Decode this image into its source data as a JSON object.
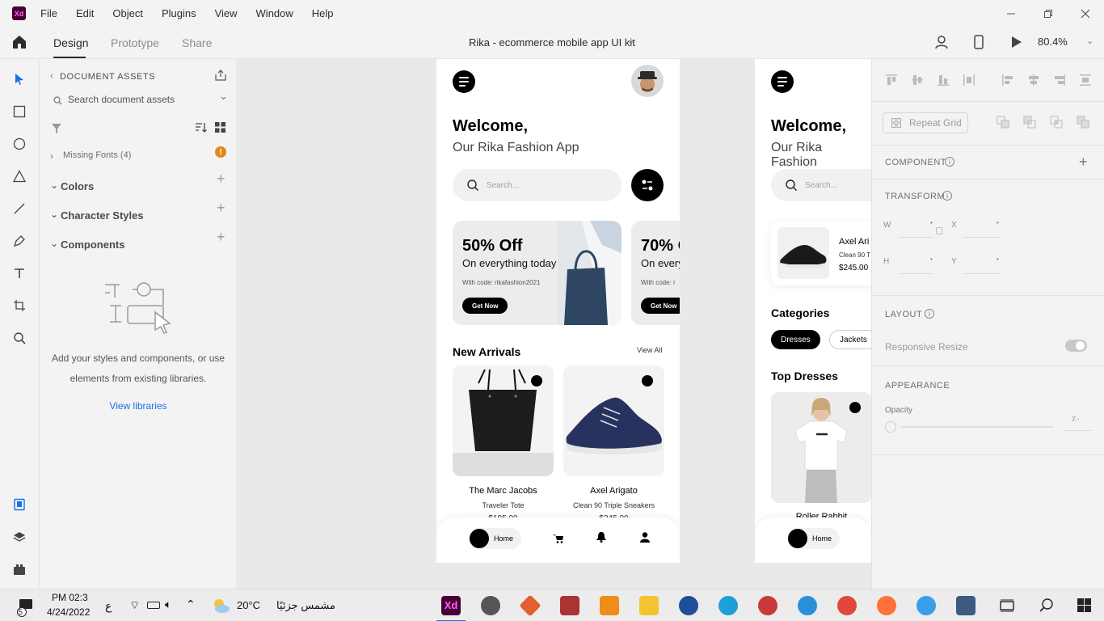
{
  "app": {
    "logo": "Xd",
    "menu": [
      "File",
      "Edit",
      "Object",
      "Plugins",
      "View",
      "Window",
      "Help"
    ],
    "window_controls": [
      "minimize-icon",
      "restore-icon",
      "close-icon"
    ]
  },
  "toolbar": {
    "tabs": [
      "Design",
      "Prototype",
      "Share"
    ],
    "active_tab": "Design",
    "doc_title": "Rika - ecommerce mobile app UI kit",
    "zoom": "80.4%"
  },
  "tools": [
    "select-icon",
    "rectangle-icon",
    "ellipse-icon",
    "polygon-icon",
    "line-icon",
    "pen-icon",
    "text-icon",
    "artboard-icon",
    "zoom-icon",
    "assets-icon",
    "layers-icon",
    "plugins-icon"
  ],
  "assets": {
    "title": "DOCUMENT ASSETS",
    "search_placeholder": "Search document assets",
    "missing_fonts": "Missing Fonts (4)",
    "sections": [
      "Colors",
      "Character Styles",
      "Components"
    ],
    "empty_text": "Add your styles and components, or use elements from existing libraries.",
    "view_libraries": "View libraries"
  },
  "artboard1": {
    "welcome": "Welcome,",
    "subtitle": "Our Rika Fashion App",
    "search_placeholder": "Search...",
    "promos": [
      {
        "headline": "50% Off",
        "sub": "On everything today",
        "code": "With code: rikafashion2021",
        "button": "Get Now"
      },
      {
        "headline": "70% O",
        "sub": "On every",
        "code": "With code: r",
        "button": "Get Now"
      }
    ],
    "new_arrivals": "New Arrivals",
    "view_all": "View All",
    "products": [
      {
        "name": "The Marc Jacobs",
        "sub": "Traveler Tote",
        "price": "$195.00"
      },
      {
        "name": "Axel Arigato",
        "sub": "Clean 90 Triple Sneakers",
        "price": "$245.00"
      }
    ],
    "nav_home": "Home"
  },
  "artboard2": {
    "welcome": "Welcome,",
    "subtitle": "Our Rika Fashion",
    "search_placeholder": "Search...",
    "product": {
      "name": "Axel Ari",
      "sub": "Clean 90 T",
      "price": "$245.00"
    },
    "categories": "Categories",
    "chips": [
      "Dresses",
      "Jackets"
    ],
    "top_dresses": "Top Dresses",
    "dress_name": "Roller Rabbit",
    "nav_home": "Home"
  },
  "props": {
    "repeat_grid": "Repeat Grid",
    "component": "COMPONENT",
    "transform": "TRANSFORM",
    "w": "W",
    "x": "X",
    "h": "H",
    "y": "Y",
    "layout": "LAYOUT",
    "responsive_resize": "Responsive Resize",
    "appearance": "APPEARANCE",
    "opacity": "Opacity",
    "opacity_value": "٪٠"
  },
  "taskbar": {
    "time": "PM 02:3",
    "date": "4/24/2022",
    "weather_temp": "20°C",
    "weather_desc": "مشمس جزئيًا",
    "lang": "ع",
    "notification_count": "5"
  },
  "colors": {
    "xd_bg": "#470137",
    "xd_fg": "#ff61f6",
    "accent": "#1473e6",
    "warning": "#e68619"
  }
}
